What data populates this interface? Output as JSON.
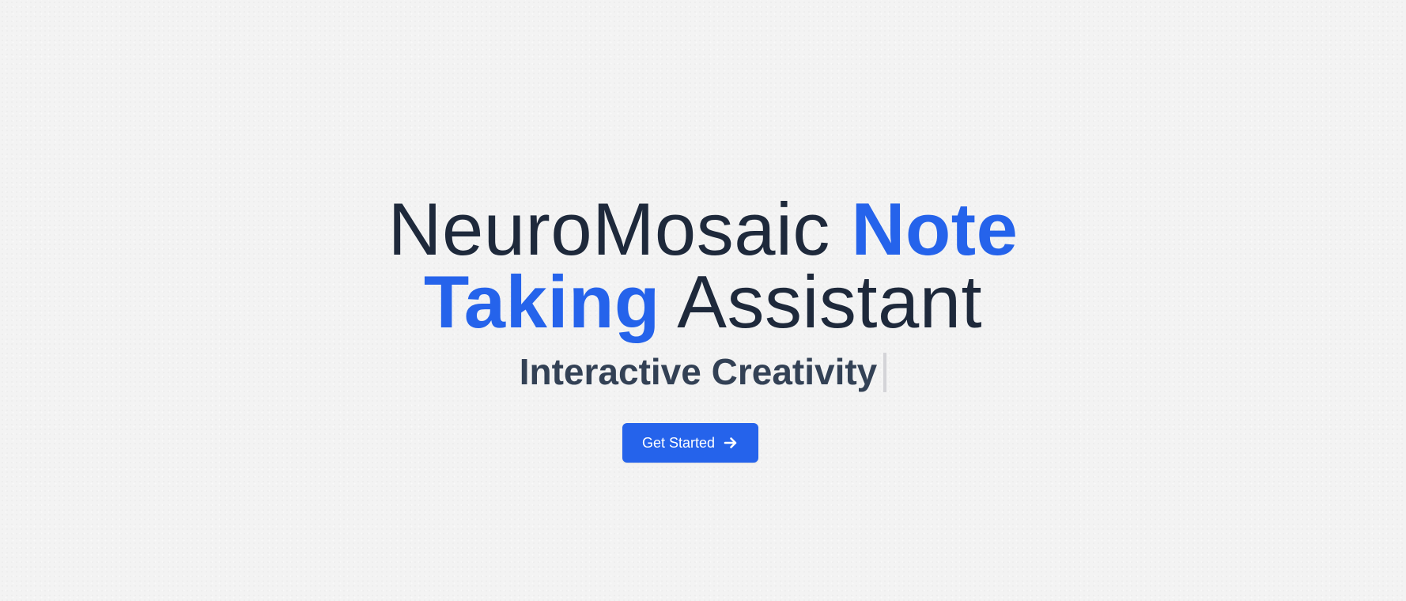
{
  "hero": {
    "title": {
      "line1_plain": "NeuroMosaic ",
      "line1_accent": "Note",
      "line2_accent": "Taking",
      "line2_plain": " Assistant"
    },
    "subtitle": "Interactive Creativity",
    "cta": {
      "label": "Get Started",
      "icon": "arrow-right-icon"
    }
  },
  "colors": {
    "background": "#f3f3f3",
    "text_dark": "#1e293b",
    "subtitle": "#334155",
    "accent": "#2563eb",
    "button_text": "#ffffff",
    "cursor": "#d4d4d8"
  }
}
